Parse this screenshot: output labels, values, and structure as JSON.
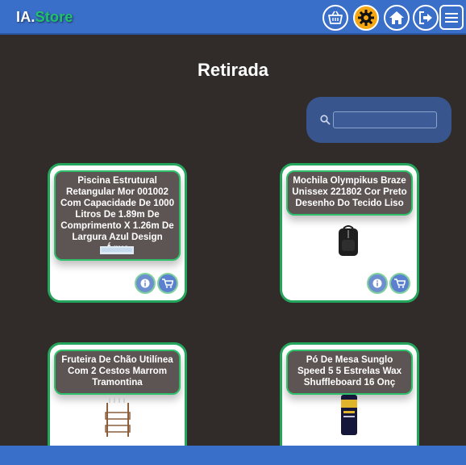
{
  "header": {
    "brand_prefix": "IA.",
    "brand_suffix": "Store",
    "nav_icons": [
      "basket-icon",
      "gear-icon",
      "home-icon",
      "logout-icon",
      "hamburger-menu-icon"
    ],
    "accent_color": "#3a6fc9",
    "active_color": "#f4a712"
  },
  "page": {
    "title": "Retirada"
  },
  "search": {
    "value": "",
    "placeholder": ""
  },
  "products": [
    {
      "title": "Piscina Estrutural Retangular Mor 001002 Com Capacidade De 1000 Litros De 1.89m De Comprimento X 1.26m De Largura Azul Design Água",
      "image": "pool-image"
    },
    {
      "title": "Mochila Olympikus Braze Unissex 221802 Cor Preto Desenho Do Tecido Liso",
      "image": "backpack-image"
    },
    {
      "title": "Fruteira De Chão Utilínea Com 2 Cestos Marrom Tramontina",
      "image": "fruit-stand-image"
    },
    {
      "title": "Pó De Mesa Sunglo Speed 5 5 Estrelas Wax Shuffleboard 16 Onç",
      "image": "wax-can-image"
    }
  ],
  "colors": {
    "background": "#312b2a",
    "card_border": "#24a55c",
    "card_title_bg": "#5d5553"
  }
}
